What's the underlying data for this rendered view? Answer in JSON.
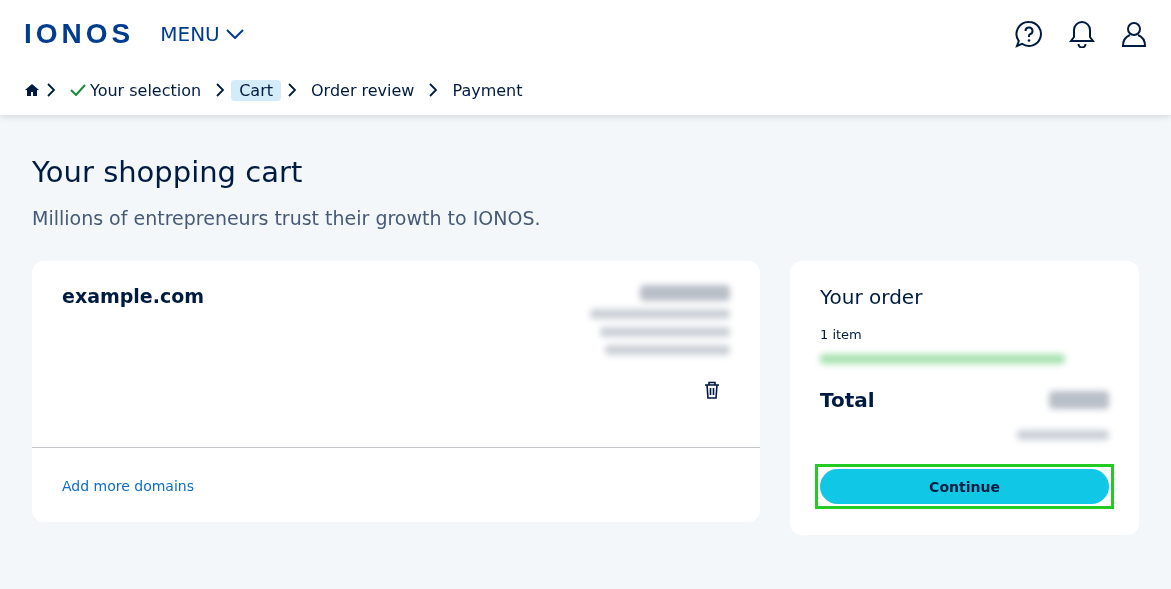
{
  "header": {
    "logo": "IONOS",
    "menu": "MENU"
  },
  "breadcrumb": [
    {
      "label": "Your selection",
      "kind": "done"
    },
    {
      "label": "Cart",
      "kind": "current"
    },
    {
      "label": "Order review",
      "kind": "upcoming"
    },
    {
      "label": "Payment",
      "kind": "upcoming"
    }
  ],
  "title": "Your shopping cart",
  "subtitle": "Millions of entrepreneurs trust their growth to IONOS.",
  "cart_item": {
    "name": "example.com",
    "link": "Add more domains"
  },
  "order": {
    "title": "Your order",
    "count": "1 item",
    "total_label": "Total",
    "button": "Continue",
    "highlighted": true
  }
}
